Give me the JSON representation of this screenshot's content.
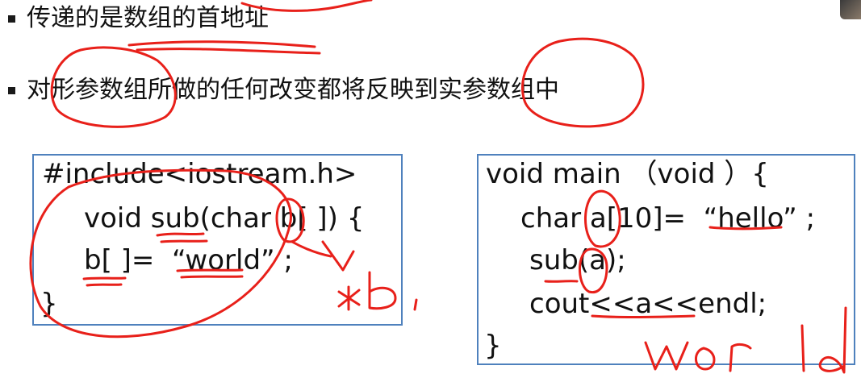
{
  "bullets": [
    "传递的是数组的首地址",
    "对形参数组所做的任何改变都将反映到实参数组中"
  ],
  "left_code": [
    "#include<iostream.h>",
    "void sub(char b[ ]) {",
    "b[ ]=  “world” ;",
    "}"
  ],
  "right_code": [
    "void main （void ）{",
    "char a[10]=  “hello” ;",
    "sub(a);",
    "cout<<a<<endl;",
    "}"
  ],
  "colors": {
    "box_border": "#4f81bd",
    "annotation_ink": "#e8201a",
    "text": "#111111"
  }
}
